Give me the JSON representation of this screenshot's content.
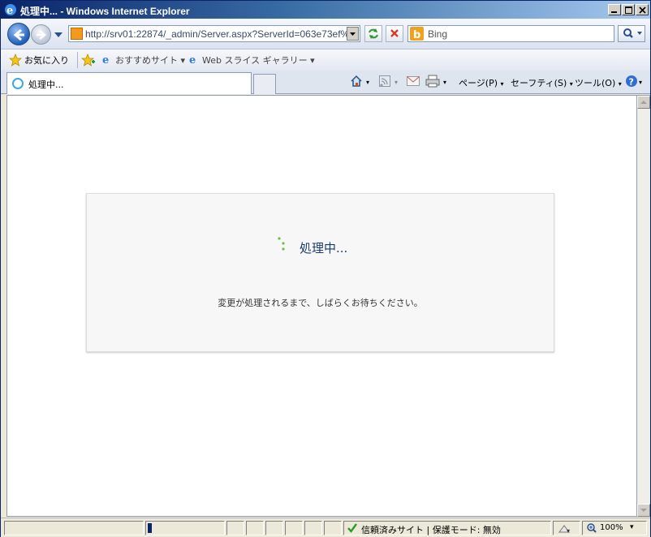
{
  "window": {
    "title": "処理中... - Windows Internet Explorer"
  },
  "address": {
    "url": "http://srv01:22874/_admin/Server.aspx?ServerId=063e73ef%2D"
  },
  "search": {
    "placeholder": "Bing"
  },
  "favorites": {
    "label": "お気に入り",
    "items": [
      {
        "label": "おすすめサイト ▾"
      },
      {
        "label": "Web スライス ギャラリー ▾"
      }
    ]
  },
  "tab": {
    "label": "処理中..."
  },
  "commands": {
    "page": "ページ(P)",
    "safety": "セーフティ(S)",
    "tools": "ツール(O)"
  },
  "processing": {
    "title": "処理中...",
    "message": "変更が処理されるまで、しばらくお待ちください。"
  },
  "status": {
    "zone": "信頼済みサイト | 保護モード: 無効",
    "zoom": "100%"
  }
}
